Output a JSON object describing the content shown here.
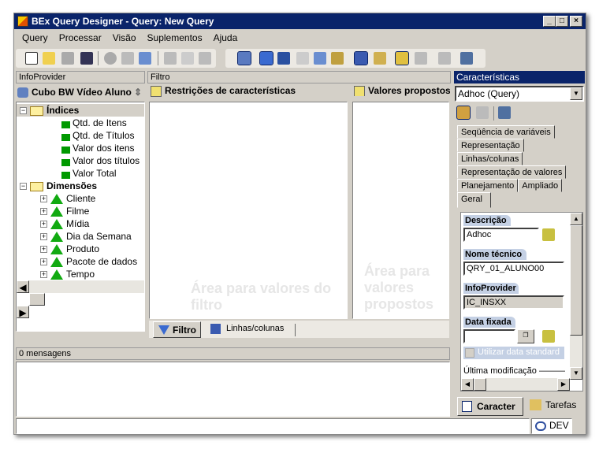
{
  "window": {
    "title": "BEx Query Designer - Query: New Query",
    "controls": [
      "_",
      "□",
      "×"
    ]
  },
  "menu": [
    "Query",
    "Processar",
    "Visão",
    "Suplementos",
    "Ajuda"
  ],
  "infoprovider": {
    "header": "InfoProvider",
    "cube": "Cubo BW Vídeo Aluno",
    "tree": {
      "indices_label": "Índices",
      "key_figures": [
        "Qtd. de Itens",
        "Qtd. de Títulos",
        "Valor dos itens",
        "Valor dos títulos",
        "Valor Total"
      ],
      "dimensions_label": "Dimensões",
      "dimensions": [
        "Cliente",
        "Filme",
        "Mídia",
        "Dia da Semana",
        "Produto",
        "Pacote de dados",
        "Tempo"
      ]
    }
  },
  "filter": {
    "header": "Filtro",
    "restrictions_title": "Restrições de características",
    "proposed_title": "Valores propostos",
    "restrictions_placeholder": "Área para valores do filtro",
    "proposed_placeholder": "Área para valores propostos",
    "tabs": [
      {
        "label": "Filtro",
        "active": true
      },
      {
        "label": "Linhas/colunas",
        "active": false
      }
    ]
  },
  "messages": {
    "header": "0 mensagens"
  },
  "properties": {
    "header": "Características",
    "selector": "Adhoc (Query)",
    "tabs": [
      "Seqüência de variáveis",
      "Representação",
      "Linhas/colunas",
      "Representação de valores",
      "Planejamento",
      "Ampliado",
      "Geral"
    ],
    "active_tab": "Geral",
    "descricao_label": "Descrição",
    "descricao_value": "Adhoc",
    "nome_label": "Nome técnico",
    "nome_value": "QRY_01_ALUNO00",
    "infoprovider_label": "InfoProvider",
    "infoprovider_value": "IC_INSXX",
    "data_label": "Data fixada",
    "data_value": "",
    "std_date_label": "Utilizar data standard",
    "std_date_checked": false,
    "last_mod_label": "Última modificação",
    "bottom_tabs": [
      {
        "label": "Caracter",
        "active": true
      },
      {
        "label": "Tarefas",
        "active": false
      }
    ]
  },
  "status": {
    "system": "DEV"
  },
  "colors": {
    "title_bar": "#0a246a",
    "face": "#d4d0c8",
    "group_label": "#c4d0e4"
  }
}
